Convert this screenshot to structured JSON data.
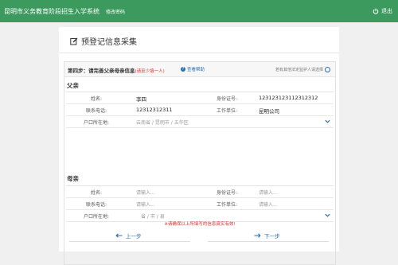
{
  "header": {
    "system_title": "昆明市义务教育阶段招生入学系统",
    "change_password": "修改密码",
    "logout": "退出"
  },
  "panel": {
    "title": "预登记信息采集"
  },
  "step": {
    "title": "第四步：请完善父亲母亲信息",
    "note": "(请至少填一人)",
    "help": "查看帮助",
    "guardian_option": "若有其他法定监护人请选择"
  },
  "labels": {
    "name": "姓名:",
    "id_number": "身份证号:",
    "phone": "联系电话:",
    "employer": "工作单位:",
    "household": "户口所在地:"
  },
  "father": {
    "section": "父亲",
    "name": "李四",
    "id_number": "123123123112312312",
    "phone": "12312312311",
    "employer": "昆明公司",
    "province": "云南省",
    "city": "昆明市",
    "district": "五华区"
  },
  "mother": {
    "section": "母亲",
    "placeholder": "请输入...",
    "province": "省",
    "city": "市",
    "district": "县"
  },
  "footer": {
    "warning": "※请确保以上所填写的信息真实有效!",
    "prev": "上一步",
    "next": "下一步"
  },
  "colors": {
    "topbar": "#3c9a5f",
    "accent": "#2a6db0",
    "warning": "#d9302c"
  }
}
